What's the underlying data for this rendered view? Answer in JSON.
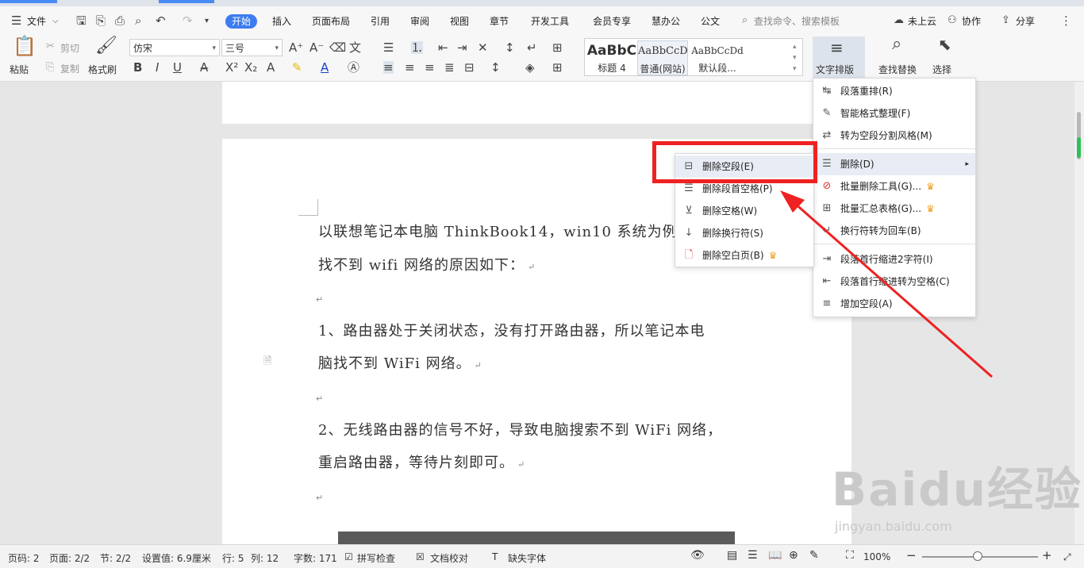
{
  "tabs": {
    "file": "文件",
    "items": [
      "开始",
      "插入",
      "页面布局",
      "引用",
      "审阅",
      "视图",
      "章节",
      "开发工具",
      "会员专享",
      "慧办公",
      "公文"
    ],
    "search_placeholder": "查找命令、搜索模板",
    "cloud": "未上云",
    "collab": "协作",
    "share": "分享"
  },
  "ribbon": {
    "paste": "粘贴",
    "cut": "剪切",
    "copy": "复制",
    "format_painter": "格式刷",
    "font_name": "仿宋",
    "font_size": "三号",
    "styles": [
      {
        "preview": "AaBbC",
        "name": "标题 4"
      },
      {
        "preview": "AaBbCcD",
        "name": "普通(网站)"
      },
      {
        "preview": "AaBbCcDd",
        "name": "默认段..."
      }
    ],
    "text_layout": "文字排版",
    "find_replace": "查找替换",
    "select": "选择"
  },
  "document": {
    "lines": [
      "以联想笔记本电脑 ThinkBook14，win10 系统为例",
      "找不到 wifi 网络的原因如下：",
      "1、路由器处于关闭状态，没有打开路由器，所以笔记本电",
      "脑找不到 WiFi 网络。",
      "2、无线路由器的信号不好，导致电脑搜索不到 WiFi 网络，",
      "重启路由器，等待片刻即可。"
    ],
    "para_mark": "↵"
  },
  "text_layout_menu": {
    "items": [
      {
        "label": "段落重排(R)",
        "icon": "paragraph-reflow-icon"
      },
      {
        "label": "智能格式整理(F)",
        "icon": "smart-format-icon"
      },
      {
        "label": "转为空段分割风格(M)",
        "icon": "blank-paragraph-style-icon"
      },
      {
        "label": "删除(D)",
        "icon": "delete-icon"
      },
      {
        "label": "批量删除工具(G)...",
        "icon": "batch-delete-icon"
      },
      {
        "label": "批量汇总表格(G)...",
        "icon": "batch-table-icon"
      },
      {
        "label": "换行符转为回车(B)",
        "icon": "linebreak-to-enter-icon"
      },
      {
        "label": "段落首行缩进2字符(I)",
        "icon": "indent-icon"
      },
      {
        "label": "段落首行缩进转为空格(C)",
        "icon": "indent-to-space-icon"
      },
      {
        "label": "增加空段(A)",
        "icon": "add-blank-paragraph-icon"
      }
    ]
  },
  "delete_submenu": {
    "items": [
      {
        "label": "删除空段(E)",
        "icon": "delete-blank-paragraph-icon"
      },
      {
        "label": "删除段首空格(P)",
        "icon": "delete-leading-space-icon"
      },
      {
        "label": "删除空格(W)",
        "icon": "delete-space-icon"
      },
      {
        "label": "删除换行符(S)",
        "icon": "delete-linebreak-icon"
      },
      {
        "label": "删除空白页(B)",
        "icon": "delete-blank-page-icon"
      }
    ]
  },
  "status": {
    "page_num": "页码: 2",
    "pages": "页面: 2/2",
    "section": "节: 2/2",
    "setting": "设置值: 6.9厘米",
    "row": "行: 5",
    "col": "列: 12",
    "word_count": "字数: 171",
    "spell_check": "拼写检查",
    "doc_check": "文档校对",
    "missing_font": "缺失字体",
    "zoom": "100%"
  },
  "watermark": {
    "brand": "Baidu经验",
    "url": "jingyan.baidu.com"
  },
  "colors": {
    "accent": "#3c7cf0",
    "highlight_box": "#ee2222",
    "arrow": "#ee2222"
  }
}
